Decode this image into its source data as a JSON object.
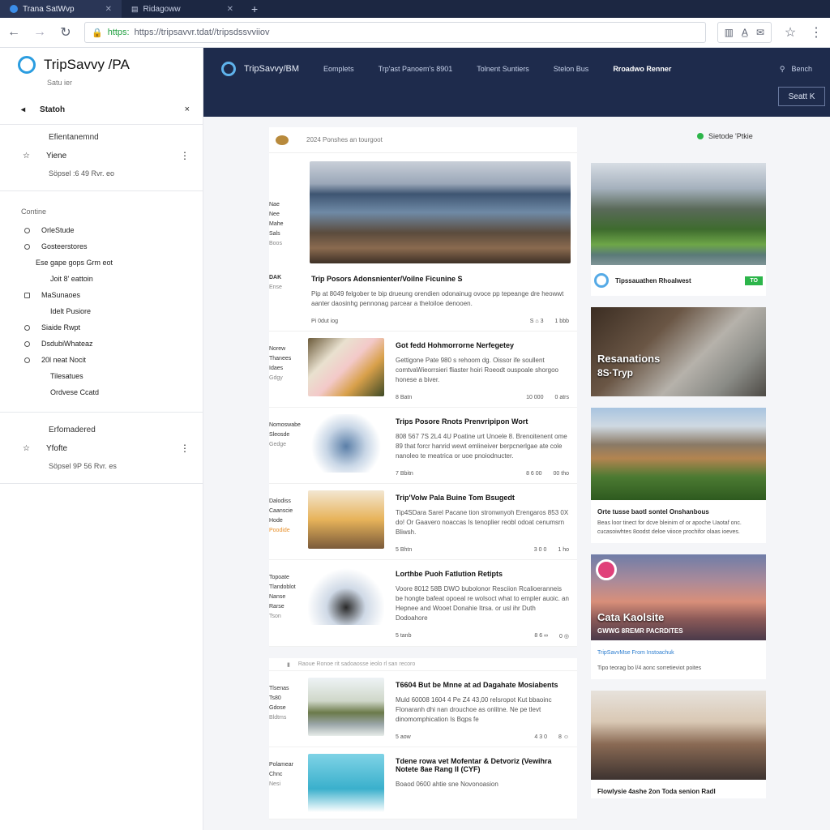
{
  "browser": {
    "tabs": [
      {
        "label": "Trana SatWvp"
      },
      {
        "label": "Ridagoww"
      }
    ],
    "new_tab": "+",
    "url_scheme": "https:",
    "url_rest": "https://tripsavvr.tdat//tripsdssvviiov"
  },
  "sidebar": {
    "brand": "TripSavvy /PA",
    "brand_sub": "Satu ier",
    "search_label": "Statoh",
    "favorites_title": "Efientanemnd",
    "favorite_name": "Yiene",
    "favorite_sub": "Söpsel :6 49 Rvr. eo",
    "categories_title": "Contine",
    "categories": [
      {
        "label": "OrleStude",
        "style": "ring"
      },
      {
        "label": "Gosteerstores",
        "style": "ring"
      },
      {
        "label": "Ese gape gops Grm eot",
        "style": "mid"
      },
      {
        "label": "Joit 8' eattoin",
        "style": "indent"
      },
      {
        "label": "MaSunaoes",
        "style": "box"
      },
      {
        "label": "Idelt Pusiore",
        "style": "indent"
      },
      {
        "label": "Siaide Rwpt",
        "style": "ring"
      },
      {
        "label": "DsdubiWhateaz",
        "style": "ring"
      },
      {
        "label": "20l neat Nocit",
        "style": "ring"
      },
      {
        "label": "Tilesatues",
        "style": "indent"
      },
      {
        "label": "Ordvese Ccatd",
        "style": "indent"
      }
    ],
    "recommended_title": "Erfomadered",
    "recommended_name": "Yfofte",
    "recommended_sub": "Söpsel 9P 56 Rvr. es"
  },
  "topnav": {
    "name": "TripSavvy/BM",
    "items": [
      "Eomplets",
      "Trp'ast Panoem's 8901",
      "Tolnent Suntiers",
      "Stelon Bus",
      "Rroadwo Renner"
    ],
    "search": "Bench",
    "start_button": "Seatt K"
  },
  "feed": {
    "header_text": "2024 Ponshes an tourgoot",
    "status": "Sietode 'Ptkie",
    "hero": {
      "meta": [
        "Nae",
        "Nee",
        "Mahe",
        "Sals",
        "Boos"
      ],
      "tag": "DAK",
      "tag_sub": "Ense",
      "title": "Trip Posors Adonsnienter/Voilne Ficunine S",
      "text": "Pip at 8049 felgober te bip drueung orendien odonainug ovoce pp tepeange dre heowwt aanter daosinhg pennonag parcear a theloiloe denooen.",
      "foot_left": "Pi 0dut iog",
      "foot_mid": "S ⌂ 3",
      "foot_right": "1 bbb"
    },
    "articles": [
      {
        "meta": [
          "Norew",
          "Thanees",
          "Idaes",
          "Gdgy"
        ],
        "title": "Got fedd Hohmorrorne Nerfegetey",
        "text": "Gettigone Pate 980 s rehoom dg. Oissor ife soullent comtvaWieorrsieri fliaster hoiri Roeodt ouspoale shorgoo honese a biver.",
        "foot_left": "8 Batn",
        "foot_mid": "10 000",
        "foot_right": "0 atrs"
      },
      {
        "meta": [
          "Nomoswabe",
          "Sleosde",
          "Gedge"
        ],
        "title": "Trips Posore Rnots Prenvripipon Wort",
        "text": "808 567 7S 2L4 4U Poatine urt Unoele 8. Brenoitenent ome 89 that forcr hanrid wewt emlineiver berpcnerlgae ate cole nanoleo te meatrica or uoe pnoiodnucter.",
        "foot_left": "7 Bbitn",
        "foot_mid": "8 6 00",
        "foot_right": "00 tho"
      },
      {
        "meta": [
          "Dalodiss",
          "Caanscie",
          "Hode",
          "Poodide"
        ],
        "title": "Trip'Volw Pala Buine Tom Bsugedt",
        "text": "Tip4SDara Sarel Pacane tion stronwnyoh Erengaros 853 0X do! Or Gaavero noaccas Is tenoplier reobl odoat cenumsrn Bliwsh.",
        "foot_left": "5 Bhtn",
        "foot_mid": "3 0 0",
        "foot_right": "1 ho"
      },
      {
        "meta": [
          "Topoate",
          "Tlandoblot",
          "Nanse",
          "Rarse",
          "Tson"
        ],
        "title": "Lorthbe Puoh Fatlution Retipts",
        "text": "Voore 8012 58B DWO bubolonor Resciion Rcalioeranneis be hongte bafeat opoeal re wolsoct what to empler auoic. an Hepnee and Wooet Donahie Itrsa. or usl ihr Duth Dodoahore",
        "foot_left": "5 tanb",
        "foot_mid": "8 6 ∞",
        "foot_right": "0 ◎"
      }
    ],
    "divider_text": "Raoue Ronoe rit sadoaosse ieolo rl san recoro",
    "articles2": [
      {
        "meta": [
          "Tlsenas",
          "Ts80",
          "Gdose",
          "Bldtms"
        ],
        "title": "T6604 But be Mnne at ad Dagahate Mosiabents",
        "text": "Muld 60008 1604 4 Pe Z4 43,00 reIsropot Kut bbaoinc Flonaranh dhi nan drouchoe as onlitne. Ne pe tlevt dinomomphication Is Bqps fe",
        "foot_left": "5 aow",
        "foot_mid": "4 3 0",
        "foot_right": "8 ☺"
      },
      {
        "meta": [
          "Polamear",
          "Chnc",
          "Nesi"
        ],
        "title": "Tdene rowa vet Mofentar & Detvoriz (Vewihra Notete 8ae Rang II (CYF)",
        "text": "Boaod 0600 ahtie sne Novonoasion",
        "foot_left": "",
        "foot_mid": "",
        "foot_right": ""
      }
    ]
  },
  "rightcol": {
    "card1_label": "Tipssauathen Rhoalwest",
    "card1_badge": "TO",
    "card2_overlay": "Resanations",
    "card2_overlay2": "8S·Tryp",
    "card3_caption": "Orte tusse baotl sontel Onshanbous",
    "card3_text": "Beas loor tinect for dcve bleinim of or apoche Uaotaf onc. cucasoiwhtes 8oodst deloe viioce prochifor olaas ioeves.",
    "card4_overlay": "Cata Kaolsite",
    "card4_overlay2": "GWWG 8REMR PACRDITES",
    "card4_link": "TripSavvMse From Instoachuk",
    "card4_text": "Tipo teorag bo l/4 aonc sorretieviot poites",
    "card5_caption": "Flowlysie 4ashe 2on Toda senion Radl"
  },
  "colors": {
    "nav_bg": "#1e2b4c",
    "accent": "#2b9de0",
    "green": "#2cb54a"
  }
}
